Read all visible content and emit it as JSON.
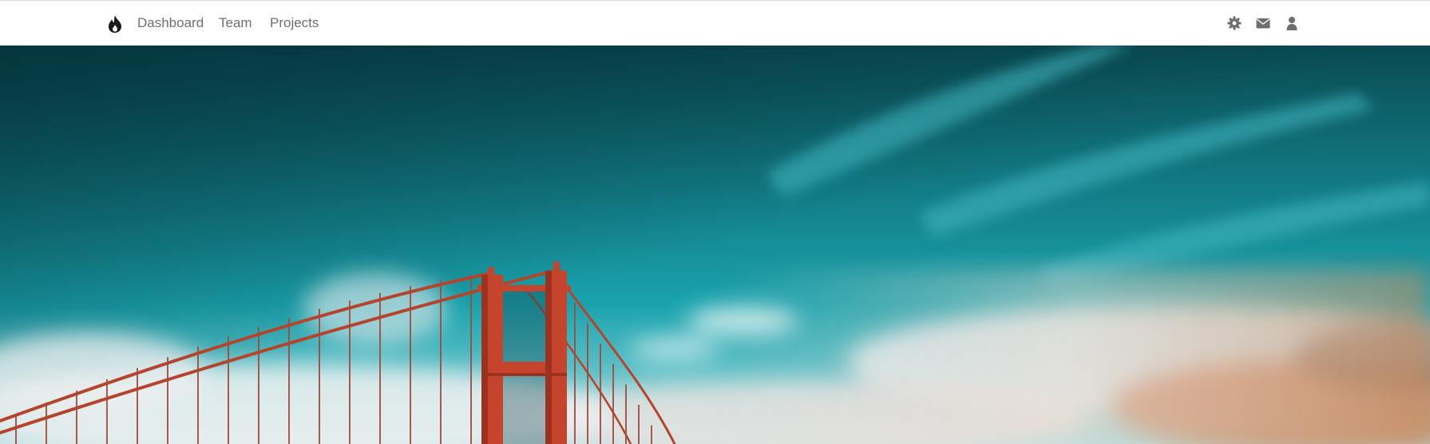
{
  "navbar": {
    "brand_icon": "flame-icon",
    "links": [
      {
        "label": "Dashboard"
      },
      {
        "label": "Team"
      },
      {
        "label": "Projects"
      }
    ],
    "actions": [
      {
        "icon": "gear-icon"
      },
      {
        "icon": "envelope-icon"
      },
      {
        "icon": "user-icon"
      }
    ]
  },
  "hero": {
    "image": "golden-gate-bridge-photo"
  },
  "colors": {
    "nav_text": "#6f6f6f",
    "nav_icon": "#6f6f6f",
    "brand": "#1a1a1a",
    "sky_top": "#0a4a52",
    "sky_mid": "#1aa3ad",
    "bridge": "#c4452c"
  }
}
